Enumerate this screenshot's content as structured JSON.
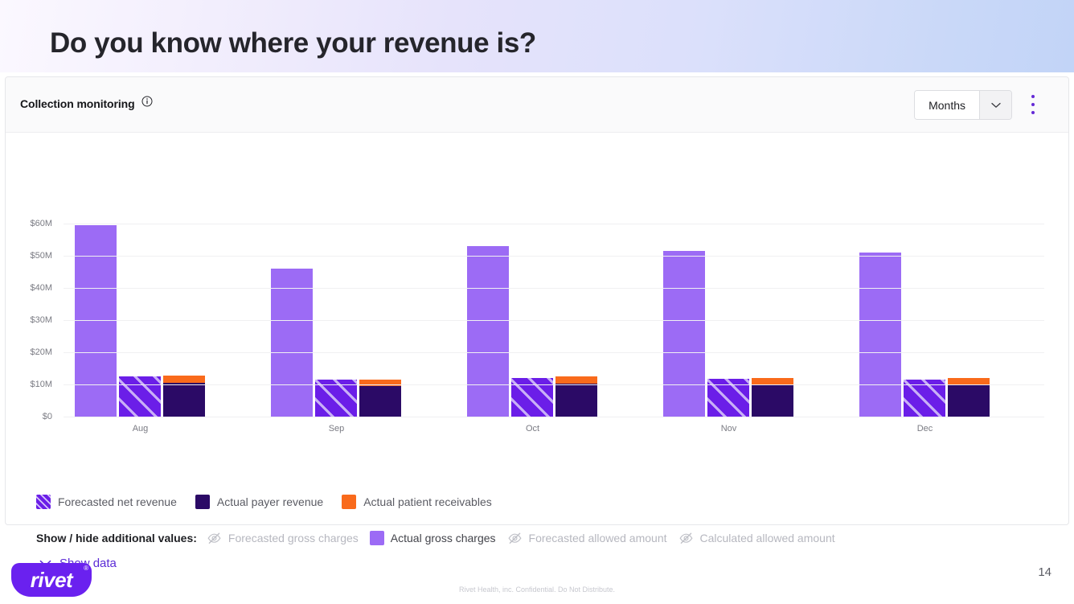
{
  "slide": {
    "title": "Do you know where your revenue is?",
    "page_number": "14",
    "footer_note": "Rivet Health, inc. Confidential. Do Not Distribute.",
    "logo_text": "rivet",
    "logo_registered": "®"
  },
  "card": {
    "title": "Collection monitoring",
    "info_icon": "info-circle-icon",
    "dropdown": {
      "value": "Months",
      "caret_icon": "chevron-down-icon",
      "options": [
        "Months"
      ]
    },
    "overflow_icon": "kebab-menu-icon",
    "accent_color": "#6429d6"
  },
  "legend": {
    "items": [
      {
        "label": "Forecasted net revenue",
        "swatch": "hatched",
        "color": "#6b1ee8"
      },
      {
        "label": "Actual payer revenue",
        "swatch": "solid",
        "color": "#2b0a66"
      },
      {
        "label": "Actual patient receivables",
        "swatch": "solid",
        "color": "#f96a1b"
      }
    ]
  },
  "show_hide": {
    "title": "Show / hide additional values:",
    "items": [
      {
        "label": "Forecasted gross charges",
        "visible": false,
        "icon": "eye-slash-icon"
      },
      {
        "label": "Actual gross charges",
        "visible": true,
        "color": "#9c6bf5"
      },
      {
        "label": "Forecasted allowed amount",
        "visible": false,
        "icon": "eye-slash-icon"
      },
      {
        "label": "Calculated allowed amount",
        "visible": false,
        "icon": "eye-slash-icon"
      }
    ]
  },
  "show_data": {
    "label": "Show data",
    "icon": "chevron-down-icon"
  },
  "chart_data": {
    "type": "bar",
    "title": "Collection monitoring",
    "xlabel": "",
    "ylabel": "",
    "ylim": [
      0,
      60
    ],
    "units": "$M",
    "grid": true,
    "legend_position": "bottom",
    "categories": [
      "Aug",
      "Sep",
      "Oct",
      "Nov",
      "Dec"
    ],
    "ticks": [
      "$0",
      "$10M",
      "$20M",
      "$30M",
      "$40M",
      "$50M",
      "$60M"
    ],
    "tick_values": [
      0,
      10,
      20,
      30,
      40,
      50,
      60
    ],
    "series": [
      {
        "name": "Actual gross charges",
        "color": "#9c6bf5",
        "style": "solid",
        "values": [
          59.5,
          46.0,
          53.0,
          51.5,
          51.0
        ]
      },
      {
        "name": "Forecasted net revenue",
        "color": "#6b1ee8",
        "style": "hatched",
        "values": [
          12.5,
          11.5,
          12.0,
          11.8,
          11.5
        ]
      },
      {
        "name": "Actual payer revenue",
        "color": "#2b0a66",
        "style": "stacked-bottom",
        "values": [
          10.5,
          9.5,
          10.2,
          10.0,
          9.8
        ]
      },
      {
        "name": "Actual patient receivables",
        "color": "#f96a1b",
        "style": "stacked-top",
        "values": [
          2.3,
          2.0,
          2.2,
          2.1,
          2.2
        ]
      }
    ]
  }
}
